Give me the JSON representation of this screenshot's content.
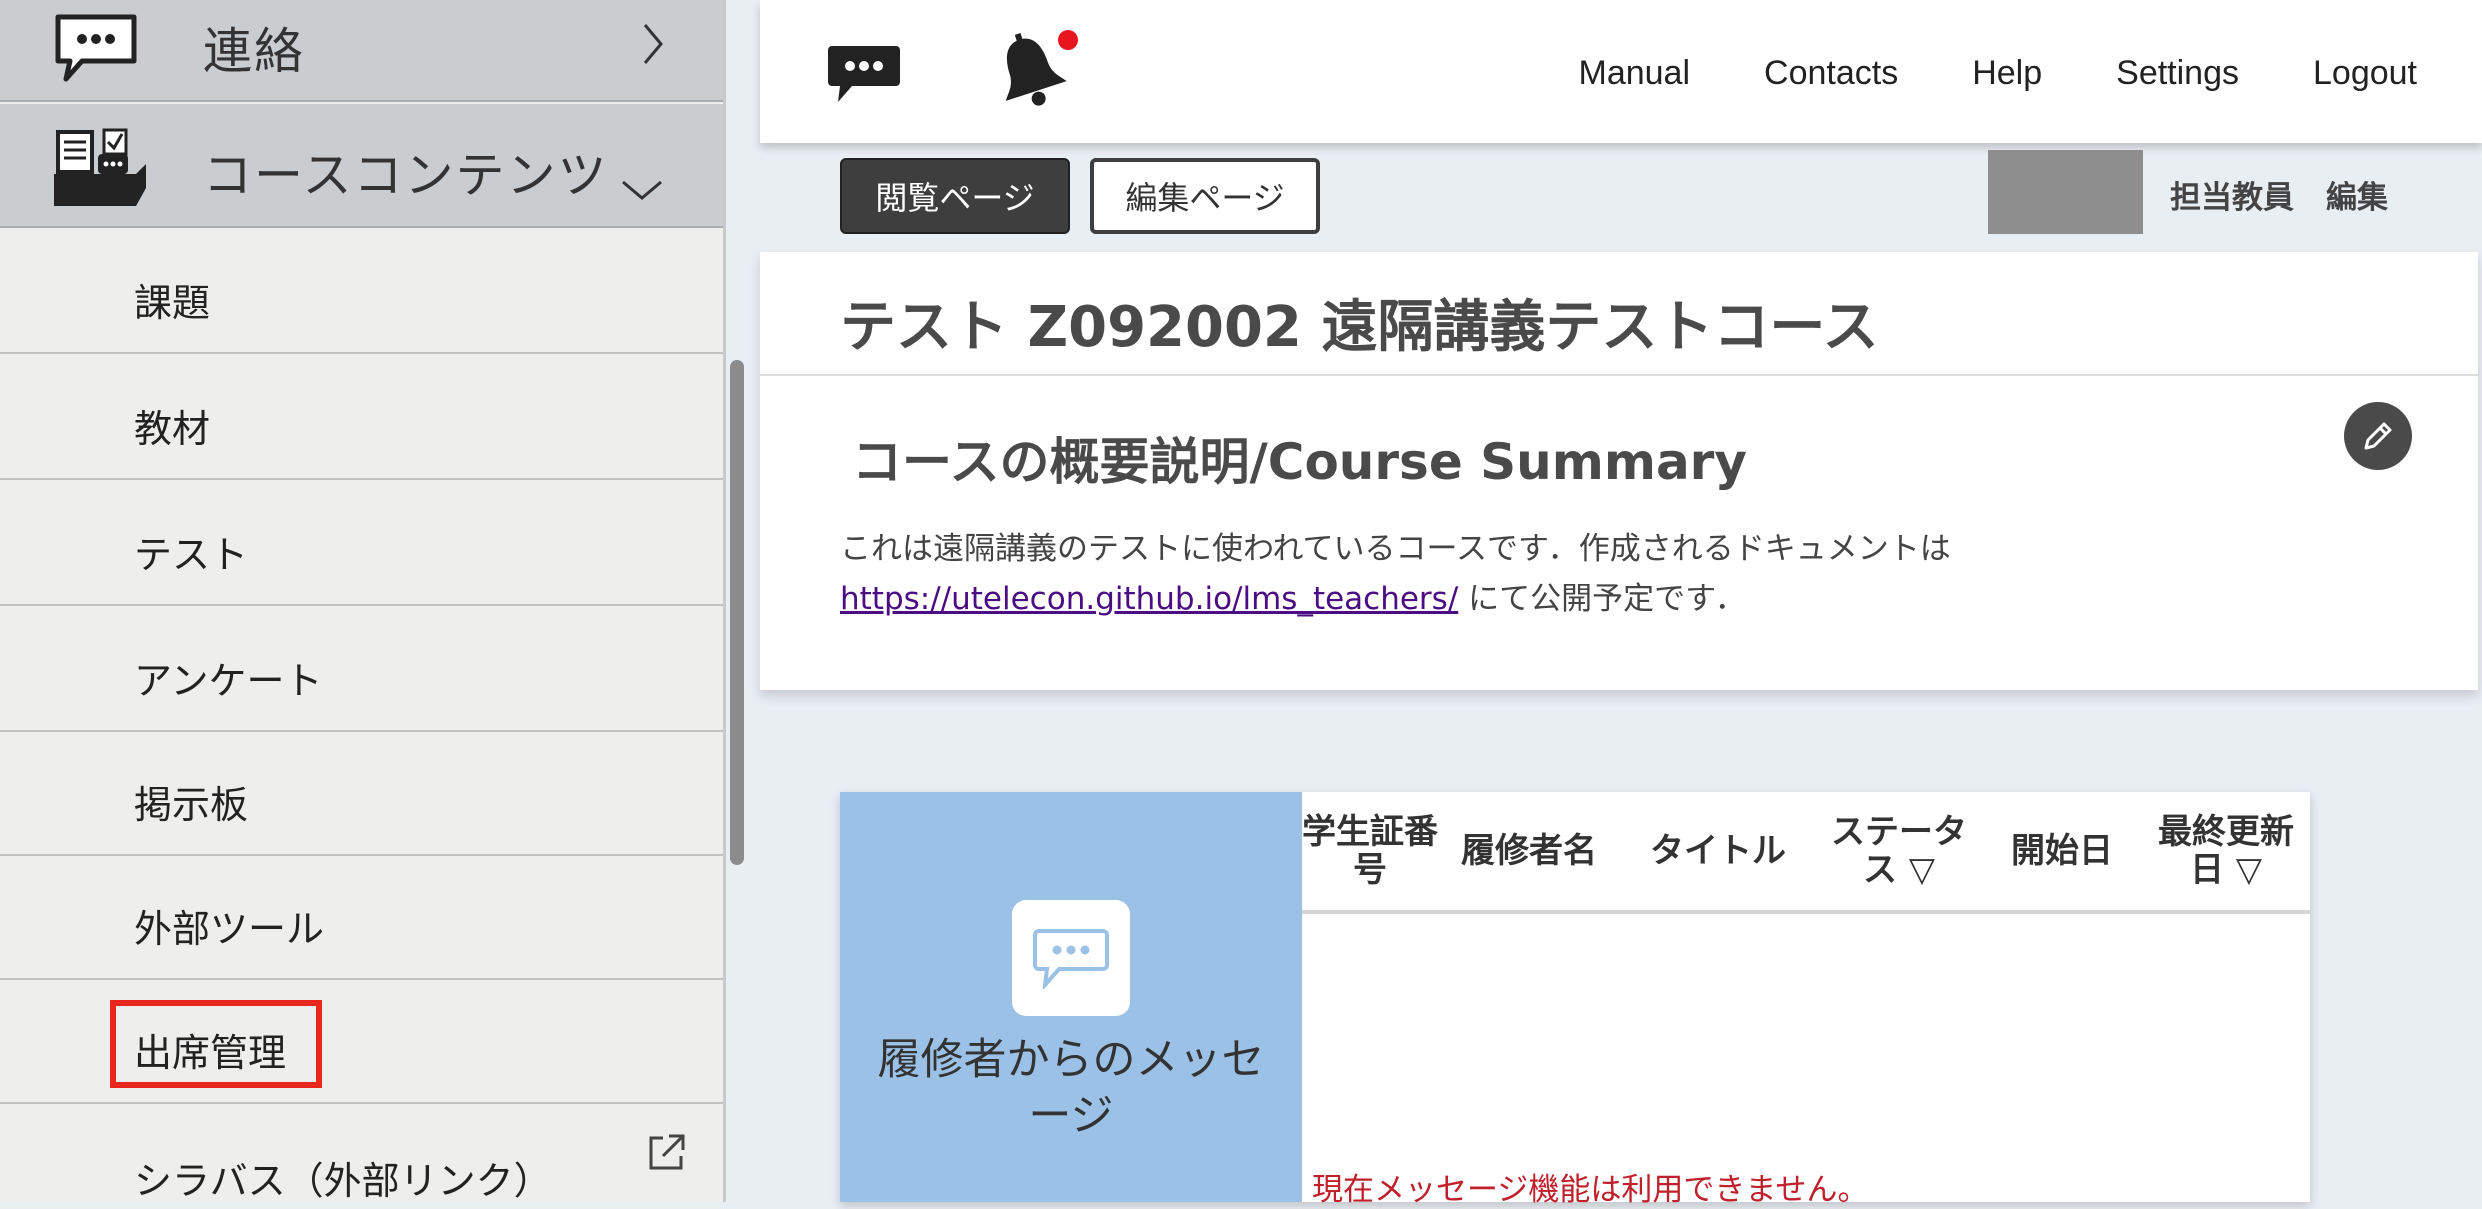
{
  "sidebar": {
    "renraku_label": "連絡",
    "course_contents_label": "コースコンテンツ",
    "items": [
      {
        "label": "課題"
      },
      {
        "label": "教材"
      },
      {
        "label": "テスト"
      },
      {
        "label": "アンケート"
      },
      {
        "label": "掲示板"
      },
      {
        "label": "外部ツール"
      },
      {
        "label": "出席管理"
      },
      {
        "label": "シラバス（外部リンク）"
      }
    ]
  },
  "header": {
    "nav": [
      "Manual",
      "Contacts",
      "Help",
      "Settings",
      "Logout"
    ]
  },
  "toolbar": {
    "view_label": "閲覧ページ",
    "edit_label": "編集ページ",
    "teacher_label": "担当教員",
    "teacher_edit_label": "編集"
  },
  "course": {
    "title": "テスト Z092002 遠隔講義テストコース",
    "summary_heading": "コースの概要説明/Course Summary",
    "summary_line1": "これは遠隔講義のテストに使われているコースです．作成されるドキュメントは",
    "summary_link": "https://utelecon.github.io/lms_teachers/",
    "summary_line2_suffix": " にて公開予定です．"
  },
  "messages": {
    "panel_label": "履修者からのメッセージ",
    "columns": [
      "学生証番号",
      "履修者名",
      "タイトル",
      "ステータス ▽",
      "開始日",
      "最終更新日 ▽"
    ],
    "empty_text": "現在メッセージ機能は利用できません。"
  },
  "colors": {
    "highlight": "#e8261e",
    "message_panel": "#9bc2e6",
    "notification_dot": "#e8141e",
    "link": "#4b0c84",
    "error_text": "#c0202b"
  }
}
